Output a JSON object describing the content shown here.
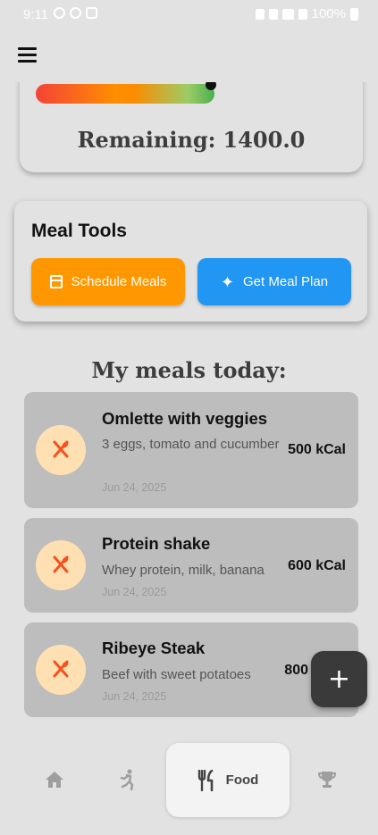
{
  "status_bar": {
    "time": "9:11",
    "battery": "100%"
  },
  "calorie_card": {
    "progress_fraction": 0.98,
    "remaining_label": "Remaining:",
    "remaining_value": "1400.0"
  },
  "meal_tools": {
    "title": "Meal Tools",
    "schedule_label": "Schedule Meals",
    "plan_label": "Get Meal Plan",
    "colors": {
      "schedule": "#ff9800",
      "plan": "#2196f3"
    }
  },
  "meals": {
    "heading": "My meals today:",
    "items": [
      {
        "name": "Omlette with veggies",
        "description": "3 eggs, tomato and cucumber",
        "date": "Jun 24, 2025",
        "kcal": "500 kCal",
        "icon": "fork-knife-icon"
      },
      {
        "name": "Protein shake",
        "description": "Whey protein, milk, banana",
        "date": "Jun 24, 2025",
        "kcal": "600 kCal",
        "icon": "fork-knife-icon"
      },
      {
        "name": "Ribeye Steak",
        "description": "Beef with sweet potatoes",
        "date": "Jun 24, 2025",
        "kcal": "800",
        "icon": "fork-knife-icon"
      }
    ]
  },
  "fab": {
    "icon": "plus-icon"
  },
  "bottom_nav": {
    "items": [
      {
        "icon": "home-icon"
      },
      {
        "icon": "running-icon"
      },
      {
        "icon": "fork-knife-icon",
        "label": "Food",
        "selected": true
      },
      {
        "icon": "trophy-icon"
      }
    ]
  }
}
